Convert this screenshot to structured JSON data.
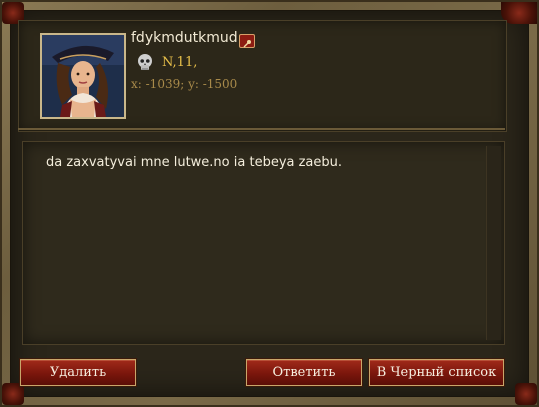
{
  "sender": {
    "name": "fdykmdutkmud",
    "level": "N,11,",
    "coords": "x: -1039; y: -1500"
  },
  "message": {
    "body": "da zaxvatyvai mne lutwe.no ia tebeya zaebu."
  },
  "buttons": {
    "delete": "Удалить",
    "reply": "Ответить",
    "blacklist": "В Черный список"
  },
  "colors": {
    "accent_gold": "#e8c04a",
    "coords_color": "#a88a4a",
    "button_red": "#8c1c12"
  },
  "icons": {
    "avatar": "pirate-woman-avatar",
    "pin": "pin-icon",
    "skull": "skull-icon"
  }
}
